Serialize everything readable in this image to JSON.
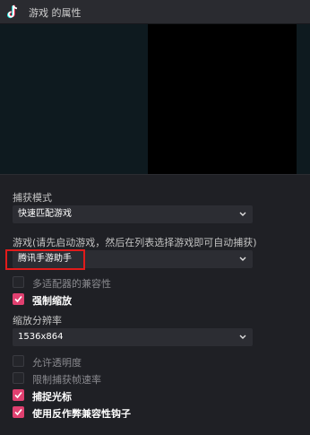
{
  "window": {
    "title": "游戏 的属性"
  },
  "capture_mode": {
    "label": "捕获模式",
    "value": "快速匹配游戏"
  },
  "game": {
    "label": "游戏(请先启动游戏，然后在列表选择游戏即可自动捕获)",
    "value": "腾讯手游助手"
  },
  "options_top": [
    {
      "label": "多适配器的兼容性",
      "checked": false
    },
    {
      "label": "强制缩放",
      "checked": true
    }
  ],
  "scale_resolution": {
    "label": "缩放分辨率",
    "value": "1536x864"
  },
  "options_bottom": [
    {
      "label": "允许透明度",
      "checked": false
    },
    {
      "label": "限制捕获帧速率",
      "checked": false
    },
    {
      "label": "捕捉光标",
      "checked": true
    },
    {
      "label": "使用反作弊兼容性钩子",
      "checked": true
    }
  ],
  "colors": {
    "accent": "#e04070",
    "highlight_box": "#e01b1b"
  }
}
